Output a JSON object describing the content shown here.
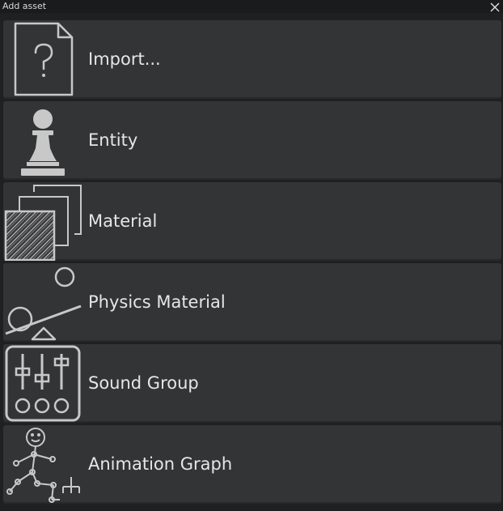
{
  "window": {
    "title": "Add asset",
    "close_icon": "close-icon"
  },
  "items": [
    {
      "label": "Import...",
      "icon": "unknown-file-icon"
    },
    {
      "label": "Entity",
      "icon": "pawn-icon"
    },
    {
      "label": "Material",
      "icon": "material-icon"
    },
    {
      "label": "Physics Material",
      "icon": "physics-material-icon"
    },
    {
      "label": "Sound Group",
      "icon": "mixer-sliders-icon"
    },
    {
      "label": "Animation Graph",
      "icon": "stick-figure-graph-icon"
    }
  ],
  "colors": {
    "background": "#1f2022",
    "item_background": "#333436",
    "text": "#e6e6e6",
    "icon": "#c8c8c8"
  }
}
